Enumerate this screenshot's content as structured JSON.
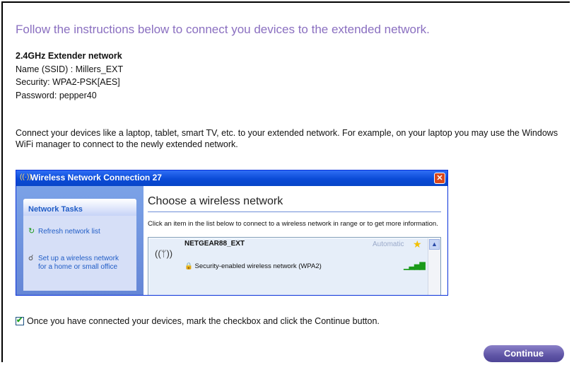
{
  "heading": "Follow the instructions below to connect you devices to the extended network.",
  "network": {
    "band_title": "2.4GHz Extender network",
    "name": "Name (SSID) : Millers_EXT",
    "security": "Security: WPA2-PSK[AES]",
    "password": "Password: pepper40"
  },
  "instructions": "Connect your devices like a laptop, tablet, smart TV, etc. to your extended network. For example, on your laptop you may use the Windows WiFi manager to connect to the newly extended network.",
  "screenshot": {
    "window_title": "Wireless Network Connection 27",
    "close_glyph": "✕",
    "tasks_header": "Network Tasks",
    "task_refresh": "Refresh network list",
    "task_setup_1": "Set up a wireless network",
    "task_setup_2": "for a home or small office",
    "choose_title": "Choose a wireless network",
    "click_text": "Click an item in the list below to connect to a wireless network in range or to get more information.",
    "ssid": "NETGEAR88_EXT",
    "connection": "Automatic",
    "security_label": "Security-enabled wireless network (WPA2)"
  },
  "confirm_text": "Once you have connected your devices, mark the checkbox and click the Continue button.",
  "confirm_checked": true,
  "continue_label": "Continue",
  "colors": {
    "heading": "#8a6fc0",
    "button": "#5f55a6"
  }
}
